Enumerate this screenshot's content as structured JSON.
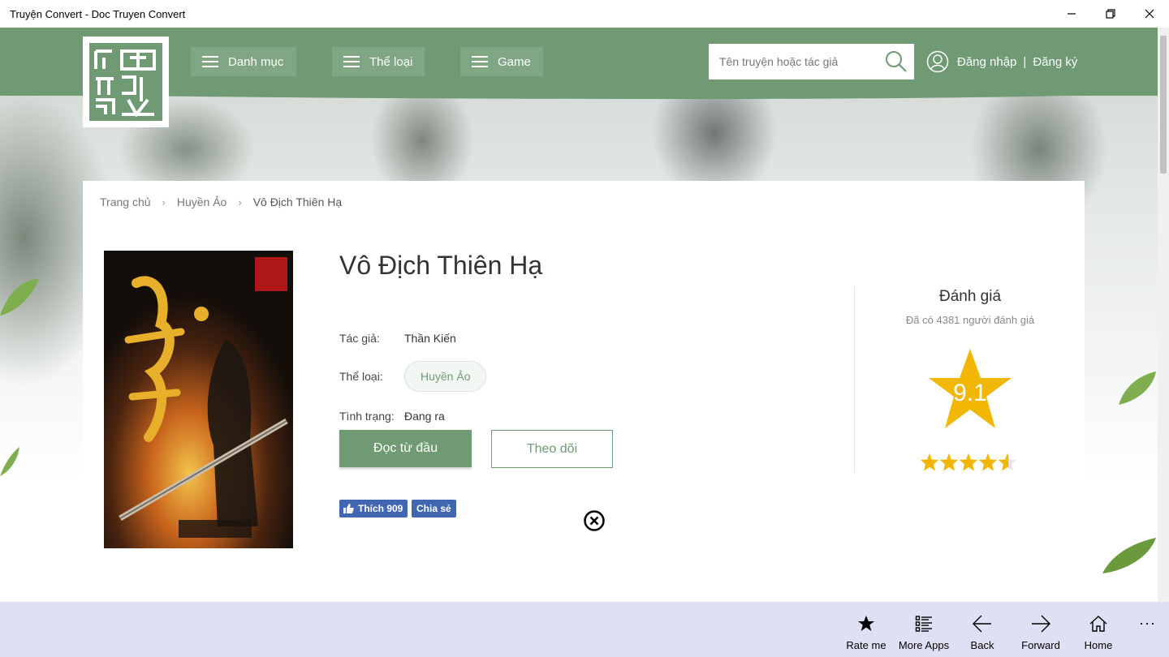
{
  "window": {
    "title": "Truyện Convert - Doc Truyen Convert",
    "controls": [
      "minimize-icon",
      "restore-icon",
      "close-icon"
    ]
  },
  "nav": {
    "items": [
      {
        "label": "Danh mục",
        "icon": "hamburger-icon"
      },
      {
        "label": "Thể loại",
        "icon": "hamburger-icon"
      },
      {
        "label": "Game",
        "icon": "hamburger-icon"
      }
    ],
    "search_placeholder": "Tên truyện hoặc tác giả",
    "login": "Đăng nhập",
    "separator": "|",
    "register": "Đăng ký"
  },
  "breadcrumb": {
    "home": "Trang chủ",
    "category": "Huyền Ảo",
    "current": "Vô Địch Thiên Hạ",
    "chevron": "›"
  },
  "book": {
    "title": "Vô Địch Thiên Hạ",
    "author_label": "Tác giả:",
    "author": "Thần Kiến",
    "genre_label": "Thể loại:",
    "genre": "Huyền Ảo",
    "status_label": "Tình trạng:",
    "status": "Đang ra",
    "read_button": "Đọc từ đầu",
    "follow_button": "Theo dõi"
  },
  "social": {
    "like_label": "Thích 909",
    "share_label": "Chia sẻ"
  },
  "rating": {
    "title": "Đánh giá",
    "subtitle": "Đã có 4381 người đánh giá",
    "score": "9.1",
    "stars_fraction": 0.91
  },
  "appbar": {
    "buttons": [
      {
        "label": "Rate me",
        "icon": "star-icon"
      },
      {
        "label": "More Apps",
        "icon": "list-icon"
      },
      {
        "label": "Back",
        "icon": "arrow-left-icon"
      },
      {
        "label": "Forward",
        "icon": "arrow-right-icon"
      },
      {
        "label": "Home",
        "icon": "home-icon"
      }
    ],
    "more": "···"
  },
  "colors": {
    "brand_green": "#6f9a74",
    "star_gold": "#f2b705",
    "facebook_blue": "#4267b2",
    "appbar_bg": "#e0e0f4"
  }
}
